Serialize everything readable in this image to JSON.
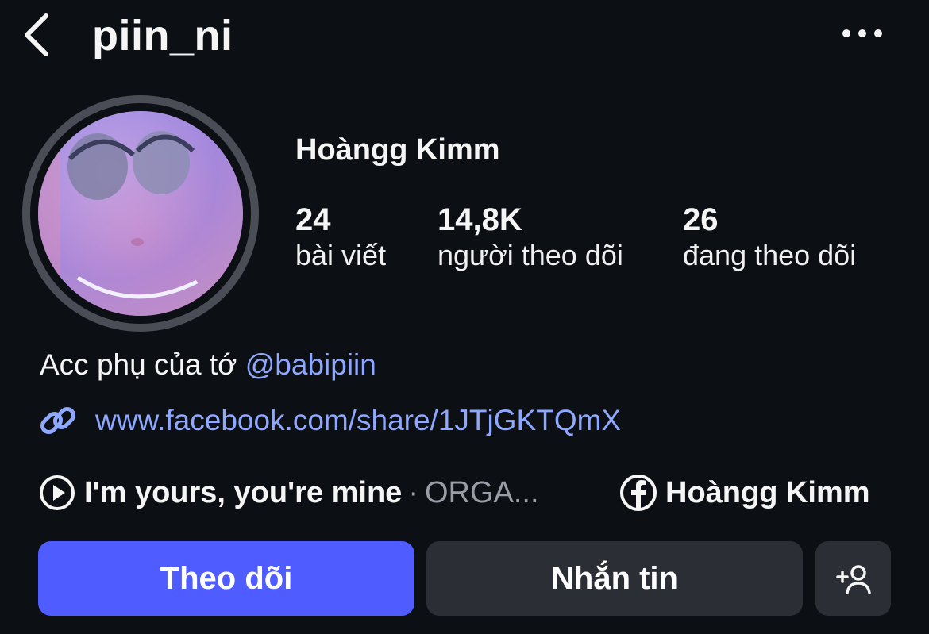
{
  "header": {
    "username": "piin_ni",
    "back_icon": "chevron-left-icon",
    "more_icon": "more-horizontal-icon"
  },
  "profile": {
    "display_name": "Hoàngg Kimm",
    "stats": [
      {
        "value": "24",
        "label": "bài viết"
      },
      {
        "value": "14,8K",
        "label": "người theo dõi"
      },
      {
        "value": "26",
        "label": "đang theo dõi"
      }
    ],
    "bio_text": "Acc phụ của tớ ",
    "bio_mention": "@babipiin",
    "link": "www.facebook.com/share/1JTjGKTQmX",
    "music_title": "I'm yours, you're mine",
    "music_separator": "·",
    "music_artist": "ORGA...",
    "facebook_name": "Hoàngg Kimm"
  },
  "actions": {
    "follow_label": "Theo dõi",
    "message_label": "Nhắn tin",
    "add_user_icon": "add-user-icon"
  },
  "colors": {
    "background": "#0c0f14",
    "accent": "#4f5cff",
    "link": "#8ea8ff",
    "secondary_button": "#2b2e34"
  }
}
